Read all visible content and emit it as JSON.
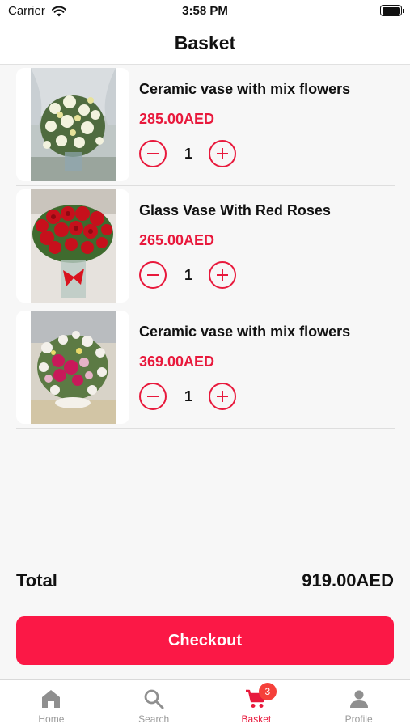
{
  "status_bar": {
    "carrier": "Carrier",
    "time": "3:58 PM"
  },
  "header": {
    "title": "Basket"
  },
  "basket": {
    "items": [
      {
        "title": "Ceramic vase with mix flowers",
        "price": "285.00AED",
        "quantity": "1",
        "photo": "white-flower-arrangement"
      },
      {
        "title": "Glass Vase With Red Roses",
        "price": "265.00AED",
        "quantity": "1",
        "photo": "red-roses-vase"
      },
      {
        "title": "Ceramic vase with mix flowers",
        "price": "369.00AED",
        "quantity": "1",
        "photo": "pink-white-flower-arrangement"
      }
    ]
  },
  "summary": {
    "total_label": "Total",
    "total_value": "919.00AED"
  },
  "checkout": {
    "label": "Checkout"
  },
  "tab_bar": {
    "tabs": [
      {
        "label": "Home",
        "icon": "home-icon"
      },
      {
        "label": "Search",
        "icon": "search-icon"
      },
      {
        "label": "Basket",
        "icon": "cart-icon",
        "badge": "3",
        "active": true
      },
      {
        "label": "Profile",
        "icon": "profile-icon"
      }
    ]
  },
  "colors": {
    "accent": "#e8193c",
    "checkout_button": "#fb1846",
    "badge": "#f5403a",
    "inactive_tab": "#9a9a9a"
  }
}
